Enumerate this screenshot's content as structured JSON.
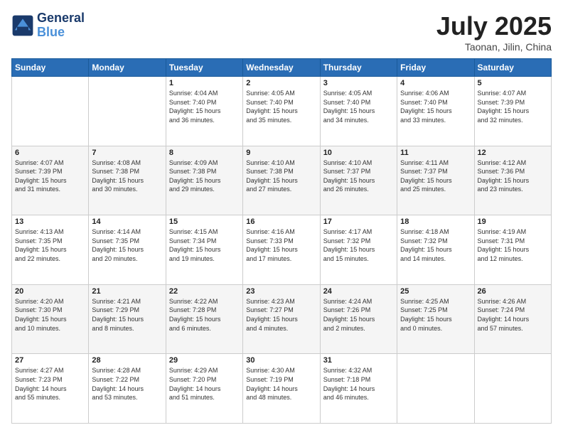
{
  "logo": {
    "line1": "General",
    "line2": "Blue"
  },
  "header": {
    "title": "July 2025",
    "subtitle": "Taonan, Jilin, China"
  },
  "weekdays": [
    "Sunday",
    "Monday",
    "Tuesday",
    "Wednesday",
    "Thursday",
    "Friday",
    "Saturday"
  ],
  "weeks": [
    [
      {
        "day": "",
        "info": ""
      },
      {
        "day": "",
        "info": ""
      },
      {
        "day": "1",
        "info": "Sunrise: 4:04 AM\nSunset: 7:40 PM\nDaylight: 15 hours\nand 36 minutes."
      },
      {
        "day": "2",
        "info": "Sunrise: 4:05 AM\nSunset: 7:40 PM\nDaylight: 15 hours\nand 35 minutes."
      },
      {
        "day": "3",
        "info": "Sunrise: 4:05 AM\nSunset: 7:40 PM\nDaylight: 15 hours\nand 34 minutes."
      },
      {
        "day": "4",
        "info": "Sunrise: 4:06 AM\nSunset: 7:40 PM\nDaylight: 15 hours\nand 33 minutes."
      },
      {
        "day": "5",
        "info": "Sunrise: 4:07 AM\nSunset: 7:39 PM\nDaylight: 15 hours\nand 32 minutes."
      }
    ],
    [
      {
        "day": "6",
        "info": "Sunrise: 4:07 AM\nSunset: 7:39 PM\nDaylight: 15 hours\nand 31 minutes."
      },
      {
        "day": "7",
        "info": "Sunrise: 4:08 AM\nSunset: 7:38 PM\nDaylight: 15 hours\nand 30 minutes."
      },
      {
        "day": "8",
        "info": "Sunrise: 4:09 AM\nSunset: 7:38 PM\nDaylight: 15 hours\nand 29 minutes."
      },
      {
        "day": "9",
        "info": "Sunrise: 4:10 AM\nSunset: 7:38 PM\nDaylight: 15 hours\nand 27 minutes."
      },
      {
        "day": "10",
        "info": "Sunrise: 4:10 AM\nSunset: 7:37 PM\nDaylight: 15 hours\nand 26 minutes."
      },
      {
        "day": "11",
        "info": "Sunrise: 4:11 AM\nSunset: 7:37 PM\nDaylight: 15 hours\nand 25 minutes."
      },
      {
        "day": "12",
        "info": "Sunrise: 4:12 AM\nSunset: 7:36 PM\nDaylight: 15 hours\nand 23 minutes."
      }
    ],
    [
      {
        "day": "13",
        "info": "Sunrise: 4:13 AM\nSunset: 7:35 PM\nDaylight: 15 hours\nand 22 minutes."
      },
      {
        "day": "14",
        "info": "Sunrise: 4:14 AM\nSunset: 7:35 PM\nDaylight: 15 hours\nand 20 minutes."
      },
      {
        "day": "15",
        "info": "Sunrise: 4:15 AM\nSunset: 7:34 PM\nDaylight: 15 hours\nand 19 minutes."
      },
      {
        "day": "16",
        "info": "Sunrise: 4:16 AM\nSunset: 7:33 PM\nDaylight: 15 hours\nand 17 minutes."
      },
      {
        "day": "17",
        "info": "Sunrise: 4:17 AM\nSunset: 7:32 PM\nDaylight: 15 hours\nand 15 minutes."
      },
      {
        "day": "18",
        "info": "Sunrise: 4:18 AM\nSunset: 7:32 PM\nDaylight: 15 hours\nand 14 minutes."
      },
      {
        "day": "19",
        "info": "Sunrise: 4:19 AM\nSunset: 7:31 PM\nDaylight: 15 hours\nand 12 minutes."
      }
    ],
    [
      {
        "day": "20",
        "info": "Sunrise: 4:20 AM\nSunset: 7:30 PM\nDaylight: 15 hours\nand 10 minutes."
      },
      {
        "day": "21",
        "info": "Sunrise: 4:21 AM\nSunset: 7:29 PM\nDaylight: 15 hours\nand 8 minutes."
      },
      {
        "day": "22",
        "info": "Sunrise: 4:22 AM\nSunset: 7:28 PM\nDaylight: 15 hours\nand 6 minutes."
      },
      {
        "day": "23",
        "info": "Sunrise: 4:23 AM\nSunset: 7:27 PM\nDaylight: 15 hours\nand 4 minutes."
      },
      {
        "day": "24",
        "info": "Sunrise: 4:24 AM\nSunset: 7:26 PM\nDaylight: 15 hours\nand 2 minutes."
      },
      {
        "day": "25",
        "info": "Sunrise: 4:25 AM\nSunset: 7:25 PM\nDaylight: 15 hours\nand 0 minutes."
      },
      {
        "day": "26",
        "info": "Sunrise: 4:26 AM\nSunset: 7:24 PM\nDaylight: 14 hours\nand 57 minutes."
      }
    ],
    [
      {
        "day": "27",
        "info": "Sunrise: 4:27 AM\nSunset: 7:23 PM\nDaylight: 14 hours\nand 55 minutes."
      },
      {
        "day": "28",
        "info": "Sunrise: 4:28 AM\nSunset: 7:22 PM\nDaylight: 14 hours\nand 53 minutes."
      },
      {
        "day": "29",
        "info": "Sunrise: 4:29 AM\nSunset: 7:20 PM\nDaylight: 14 hours\nand 51 minutes."
      },
      {
        "day": "30",
        "info": "Sunrise: 4:30 AM\nSunset: 7:19 PM\nDaylight: 14 hours\nand 48 minutes."
      },
      {
        "day": "31",
        "info": "Sunrise: 4:32 AM\nSunset: 7:18 PM\nDaylight: 14 hours\nand 46 minutes."
      },
      {
        "day": "",
        "info": ""
      },
      {
        "day": "",
        "info": ""
      }
    ]
  ]
}
